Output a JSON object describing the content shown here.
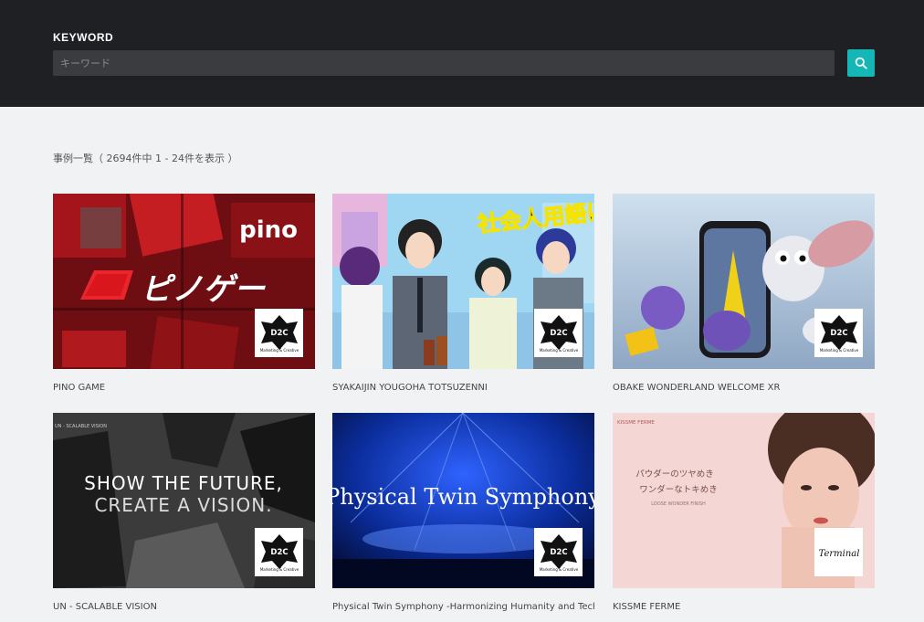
{
  "header": {
    "keyword_label": "KEYWORD",
    "search_placeholder": "キーワード",
    "search_icon": "search-icon",
    "accent_color": "#14b6b6"
  },
  "results": {
    "summary": "事例一覧（ 2694件中 1 - 24件を表示 ）"
  },
  "cards": [
    {
      "title": "PINO GAME",
      "image_text": "ピノゲー",
      "image_text_2": "pino",
      "logo": "D2C",
      "logo_sub": "Marketing & Creative"
    },
    {
      "title": "SYAKAIJIN YOUGOHA TOTSUZENNI",
      "image_text": "社会人用語は突然に",
      "logo": "D2C",
      "logo_sub": "Marketing & Creative"
    },
    {
      "title": "OBAKE WONDERLAND WELCOME XR",
      "logo": "D2C",
      "logo_sub": "Marketing & Creative"
    },
    {
      "title": "UN - SCALABLE VISION",
      "image_text": "SHOW THE FUTURE,",
      "image_text_2": "CREATE A VISION.",
      "image_text_3": "UN - SCALABLE VISION",
      "logo": "D2C",
      "logo_sub": "Marketing & Creative"
    },
    {
      "title": "Physical Twin Symphony -Harmonizing Humanity and Technology",
      "image_text": "Physical Twin Symphony",
      "logo": "D2C",
      "logo_sub": "Marketing & Creative"
    },
    {
      "title": "KISSME FERME",
      "image_text": "パウダーのツヤめき",
      "image_text_2": "ワンダーなトキめき",
      "image_text_3": "LOOSE WONDER FINISH",
      "brand": "KISSME FERME",
      "logo": "Terminal"
    }
  ]
}
